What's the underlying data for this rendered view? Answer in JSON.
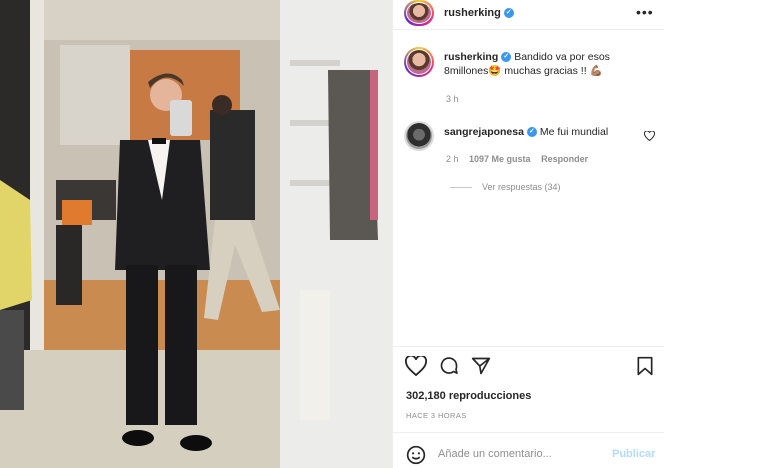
{
  "post": {
    "username": "rusherking",
    "verified_mark": "✓",
    "more_label": "•••"
  },
  "caption": {
    "username": "rusherking",
    "text_line1": "Bandido va por esos",
    "text_line2": "8millones",
    "emoji_smile": "🤩",
    "text_line2b": " muchas gracias !! ",
    "emoji_muscle": "💪🏽",
    "time": "3 h"
  },
  "comment": {
    "username": "sangrejaponesa",
    "text": "Me fui mundial",
    "time": "2 h",
    "likes": "1097 Me gusta",
    "reply": "Responder",
    "view_replies": "Ver respuestas (34)"
  },
  "actions": {
    "views": "302,180 reproducciones",
    "ago": "HACE 3 HORAS",
    "comment_placeholder": "Añade un comentario...",
    "publish": "Publicar"
  },
  "colors": {
    "verified": "#3897f0",
    "text": "#262626",
    "muted": "#8e8e8e",
    "publish": "#b3dbff"
  },
  "icons": [
    "heart-icon",
    "comment-icon",
    "share-icon",
    "bookmark-icon",
    "emoji-icon",
    "like-comment-icon",
    "more-icon",
    "verified-icon"
  ]
}
